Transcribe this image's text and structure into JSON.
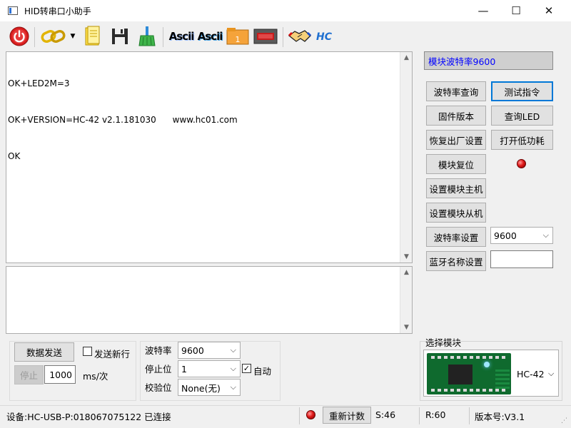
{
  "window": {
    "title": "HID转串口小助手",
    "min": "—",
    "max": "☐",
    "close": "✕"
  },
  "toolbar": {
    "ascii1": "Ascii",
    "ascii2": "Ascii",
    "folder_num": "1",
    "hc_logo": "HC"
  },
  "receive": {
    "lines": [
      "OK+LED2M=3",
      "OK+VERSION=HC-42 v2.1.181030      www.hc01.com",
      "OK"
    ]
  },
  "send": {
    "text": ""
  },
  "right_panel": {
    "module_baud_display": "模块波特率9600",
    "buttons": {
      "baud_query": "波特率查询",
      "test_cmd": "测试指令",
      "firmware": "固件版本",
      "query_led": "查询LED",
      "factory_reset": "恢复出厂设置",
      "low_power": "打开低功耗",
      "module_reset": "模块复位",
      "set_master": "设置模块主机",
      "set_slave": "设置模块从机",
      "baud_set": "波特率设置",
      "bt_name_set": "蓝牙名称设置"
    },
    "baud_select_value": "9600",
    "bt_name_value": "",
    "select_module_label": "选择模块",
    "module_name": "HC-42"
  },
  "bottom": {
    "send_button": "数据发送",
    "newline_label": "发送新行",
    "stop_button": "停止",
    "interval_value": "1000",
    "interval_unit": "ms/次",
    "baud_label": "波特率",
    "baud_value": "9600",
    "stopbit_label": "停止位",
    "stopbit_value": "1",
    "auto_label": "自动",
    "auto_checked": "✓",
    "parity_label": "校验位",
    "parity_value": "None(无)"
  },
  "status": {
    "device": "设备:HC-USB-P:018067075122 已连接",
    "recount": "重新计数",
    "sent": "S:46",
    "received": "R:60",
    "version": "版本号:V3.1"
  },
  "colors": {
    "accent": "#0078d7",
    "display_text": "#0000ff",
    "power_red": "#d81e1e"
  }
}
